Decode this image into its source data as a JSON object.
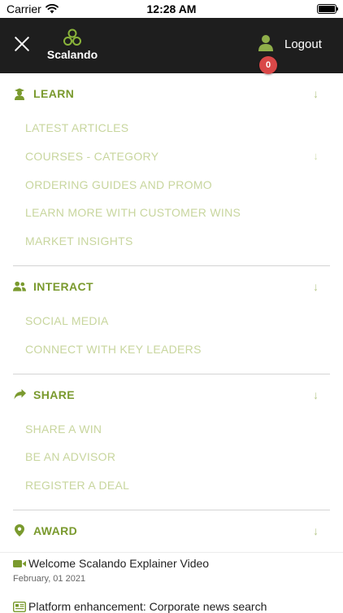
{
  "status_bar": {
    "carrier": "Carrier",
    "time": "12:28 AM"
  },
  "header": {
    "logo_text": "Scalando",
    "logout_label": "Logout",
    "notification_count": "0"
  },
  "colors": {
    "accent": "#7a9a2e",
    "link_light": "#c8d69e",
    "header_bg": "#1e1e1e",
    "badge": "#d94848"
  },
  "menu": [
    {
      "title": "LEARN",
      "icon": "graduate-icon",
      "items": [
        "LATEST ARTICLES",
        "COURSES - CATEGORY",
        "ORDERING GUIDES AND PROMO",
        "LEARN MORE WITH CUSTOMER WINS",
        "MARKET INSIGHTS"
      ]
    },
    {
      "title": "INTERACT",
      "icon": "users-icon",
      "items": [
        "SOCIAL MEDIA",
        "CONNECT WITH KEY LEADERS"
      ]
    },
    {
      "title": "SHARE",
      "icon": "share-icon",
      "items": [
        "SHARE A WIN",
        "BE AN ADVISOR",
        "REGISTER A DEAL"
      ]
    },
    {
      "title": "AWARD",
      "icon": "location-icon",
      "items": []
    }
  ],
  "news": [
    {
      "title": "Welcome Scalando Explainer Video",
      "date": "February, 01 2021",
      "icon": "video-icon"
    },
    {
      "title": "Platform enhancement: Corporate news search",
      "icon": "news-icon"
    }
  ]
}
